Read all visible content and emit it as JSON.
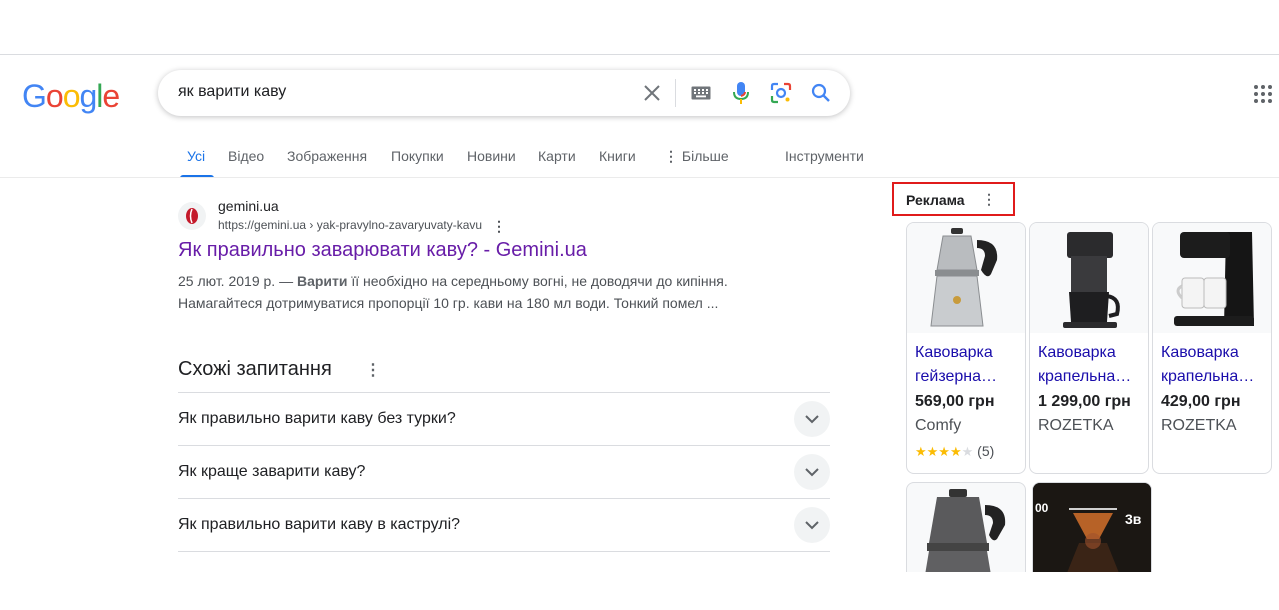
{
  "logo": {
    "text": "Google",
    "letters": [
      "G",
      "o",
      "o",
      "g",
      "l",
      "e"
    ],
    "colors": [
      "#4285f4",
      "#ea4335",
      "#fbbc05",
      "#4285f4",
      "#34a853",
      "#ea4335"
    ]
  },
  "search": {
    "query": "як варити каву"
  },
  "tabs": [
    {
      "label": "Усі",
      "active": true
    },
    {
      "label": "Відео"
    },
    {
      "label": "Зображення"
    },
    {
      "label": "Покупки"
    },
    {
      "label": "Новини"
    },
    {
      "label": "Карти"
    },
    {
      "label": "Книги"
    },
    {
      "label": "Більше"
    },
    {
      "label": "Інструменти"
    }
  ],
  "result": {
    "site_name": "gemini.ua",
    "url": "https://gemini.ua › yak-pravylno-zavaryuvaty-kavu",
    "title": "Як правильно заварювати каву? - Gemini.ua",
    "date": "25 лют. 2019 р. — ",
    "snippet_bold": "Варити",
    "snippet_rest": " її необхідно на середньому вогні, не доводячи до кипіння. Намагайтеся дотримуватися пропорції 10 гр. кави на 180 мл води. Тонкий помел ..."
  },
  "paa": {
    "title": "Схожі запитання",
    "questions": [
      "Як правильно варити каву без турки?",
      "Як краще заварити каву?",
      "Як правильно варити каву в каструлі?"
    ]
  },
  "ads": {
    "label": "Реклама",
    "products": [
      {
        "name": "Кавоварка гейзерна…",
        "price": "569,00 грн",
        "store": "Comfy",
        "rating": 3.5,
        "reviews": "(5)"
      },
      {
        "name": "Кавоварка крапельна…",
        "price": "1 299,00 грн",
        "store": "ROZETKA"
      },
      {
        "name": "Кавоварка крапельна…",
        "price": "429,00 грн",
        "store": "ROZETKA"
      }
    ],
    "partial_image_text": [
      "00",
      "3в"
    ]
  },
  "colors": {
    "accent": "#1a73e8",
    "visited": "#681da8",
    "link": "#1a0dab",
    "ad_highlight": "#e01b1b"
  }
}
